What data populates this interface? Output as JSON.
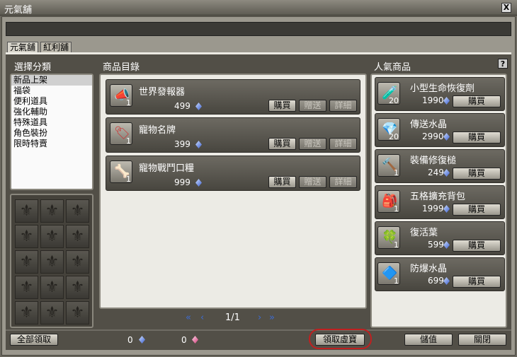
{
  "window": {
    "title": "元氣舖",
    "close_label": "X"
  },
  "tabs": [
    {
      "label": "元氣舖"
    },
    {
      "label": "紅利舖"
    }
  ],
  "headers": {
    "categories": "選擇分類",
    "catalog": "商品目錄",
    "popular": "人氣商品",
    "help": "?"
  },
  "categories": [
    {
      "label": "新品上架",
      "selected": true
    },
    {
      "label": "福袋"
    },
    {
      "label": "便利道具"
    },
    {
      "label": "強化輔助"
    },
    {
      "label": "特殊道具"
    },
    {
      "label": "角色裝扮"
    },
    {
      "label": "限時特賣"
    }
  ],
  "catalog": {
    "items": [
      {
        "name": "世界發報器",
        "price": "499",
        "qty": "1",
        "icon": "megaphone-icon"
      },
      {
        "name": "寵物名牌",
        "price": "399",
        "qty": "1",
        "icon": "pet-nametag-icon"
      },
      {
        "name": "寵物戰鬥口糧",
        "price": "999",
        "qty": "1",
        "icon": "pet-ration-icon"
      }
    ],
    "buttons": {
      "buy": "購買",
      "gift": "贈送",
      "detail": "詳細"
    }
  },
  "pager": {
    "first": "«",
    "prev": "‹",
    "text": "1/1",
    "next": "›",
    "last": "»"
  },
  "popular": {
    "items": [
      {
        "name": "小型生命恢復劑",
        "price": "1990",
        "qty": "20",
        "icon": "potion-icon"
      },
      {
        "name": "傳送水晶",
        "price": "2990",
        "qty": "20",
        "icon": "teleport-crystal-icon"
      },
      {
        "name": "裝備修復槌",
        "price": "249",
        "qty": "1",
        "icon": "repair-hammer-icon"
      },
      {
        "name": "五格擴充背包",
        "price": "1999",
        "qty": "1",
        "icon": "backpack-icon"
      },
      {
        "name": "復活葉",
        "price": "599",
        "qty": "1",
        "icon": "clover-icon"
      },
      {
        "name": "防爆水晶",
        "price": "699",
        "qty": "1",
        "icon": "shield-crystal-icon"
      }
    ],
    "buy_label": "購買"
  },
  "footer": {
    "claim_all": "全部領取",
    "points_blue": "0",
    "points_pink": "0",
    "claim_treasure": "領取虛寶",
    "store_value": "儲值",
    "close": "關閉"
  },
  "colors": {
    "currency_blue": "#3b5fd0",
    "currency_pink": "#d23c7a",
    "highlight": "#c02020"
  }
}
